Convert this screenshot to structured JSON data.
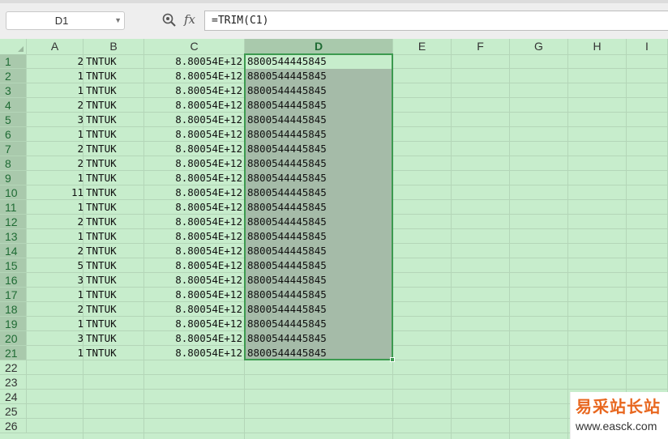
{
  "toolbar": {
    "name_box": "D1",
    "fx_label": "fx",
    "formula": "=TRIM(C1)"
  },
  "columns": [
    "A",
    "B",
    "C",
    "D",
    "E",
    "F",
    "G",
    "H",
    "I"
  ],
  "selected_column": "D",
  "row_numbers": [
    "1",
    "2",
    "3",
    "4",
    "5",
    "6",
    "7",
    "8",
    "9",
    "10",
    "11",
    "12",
    "13",
    "14",
    "15",
    "16",
    "17",
    "18",
    "19",
    "20",
    "21",
    "22",
    "23",
    "24",
    "25",
    "26"
  ],
  "rows": [
    {
      "a": "2",
      "b": "TNTUK",
      "c": "8.80054E+12",
      "d": "8800544445845"
    },
    {
      "a": "1",
      "b": "TNTUK",
      "c": "8.80054E+12",
      "d": "8800544445845"
    },
    {
      "a": "1",
      "b": "TNTUK",
      "c": "8.80054E+12",
      "d": "8800544445845"
    },
    {
      "a": "2",
      "b": "TNTUK",
      "c": "8.80054E+12",
      "d": "8800544445845"
    },
    {
      "a": "3",
      "b": "TNTUK",
      "c": "8.80054E+12",
      "d": "8800544445845"
    },
    {
      "a": "1",
      "b": "TNTUK",
      "c": "8.80054E+12",
      "d": "8800544445845"
    },
    {
      "a": "2",
      "b": "TNTUK",
      "c": "8.80054E+12",
      "d": "8800544445845"
    },
    {
      "a": "2",
      "b": "TNTUK",
      "c": "8.80054E+12",
      "d": "8800544445845"
    },
    {
      "a": "1",
      "b": "TNTUK",
      "c": "8.80054E+12",
      "d": "8800544445845"
    },
    {
      "a": "11",
      "b": "TNTUK",
      "c": "8.80054E+12",
      "d": "8800544445845"
    },
    {
      "a": "1",
      "b": "TNTUK",
      "c": "8.80054E+12",
      "d": "8800544445845"
    },
    {
      "a": "2",
      "b": "TNTUK",
      "c": "8.80054E+12",
      "d": "8800544445845"
    },
    {
      "a": "1",
      "b": "TNTUK",
      "c": "8.80054E+12",
      "d": "8800544445845"
    },
    {
      "a": "2",
      "b": "TNTUK",
      "c": "8.80054E+12",
      "d": "8800544445845"
    },
    {
      "a": "5",
      "b": "TNTUK",
      "c": "8.80054E+12",
      "d": "8800544445845"
    },
    {
      "a": "3",
      "b": "TNTUK",
      "c": "8.80054E+12",
      "d": "8800544445845"
    },
    {
      "a": "1",
      "b": "TNTUK",
      "c": "8.80054E+12",
      "d": "8800544445845"
    },
    {
      "a": "2",
      "b": "TNTUK",
      "c": "8.80054E+12",
      "d": "8800544445845"
    },
    {
      "a": "1",
      "b": "TNTUK",
      "c": "8.80054E+12",
      "d": "8800544445845"
    },
    {
      "a": "3",
      "b": "TNTUK",
      "c": "8.80054E+12",
      "d": "8800544445845"
    },
    {
      "a": "1",
      "b": "TNTUK",
      "c": "8.80054E+12",
      "d": "8800544445845"
    }
  ],
  "watermark": {
    "site_name": "易采站长站",
    "url": "www.easck.com"
  },
  "colors": {
    "eye_protection_green": "#c7edcc",
    "selection_border": "#3c9a4f",
    "selection_fill": "#a5bba8",
    "watermark_accent": "#e8671f"
  }
}
